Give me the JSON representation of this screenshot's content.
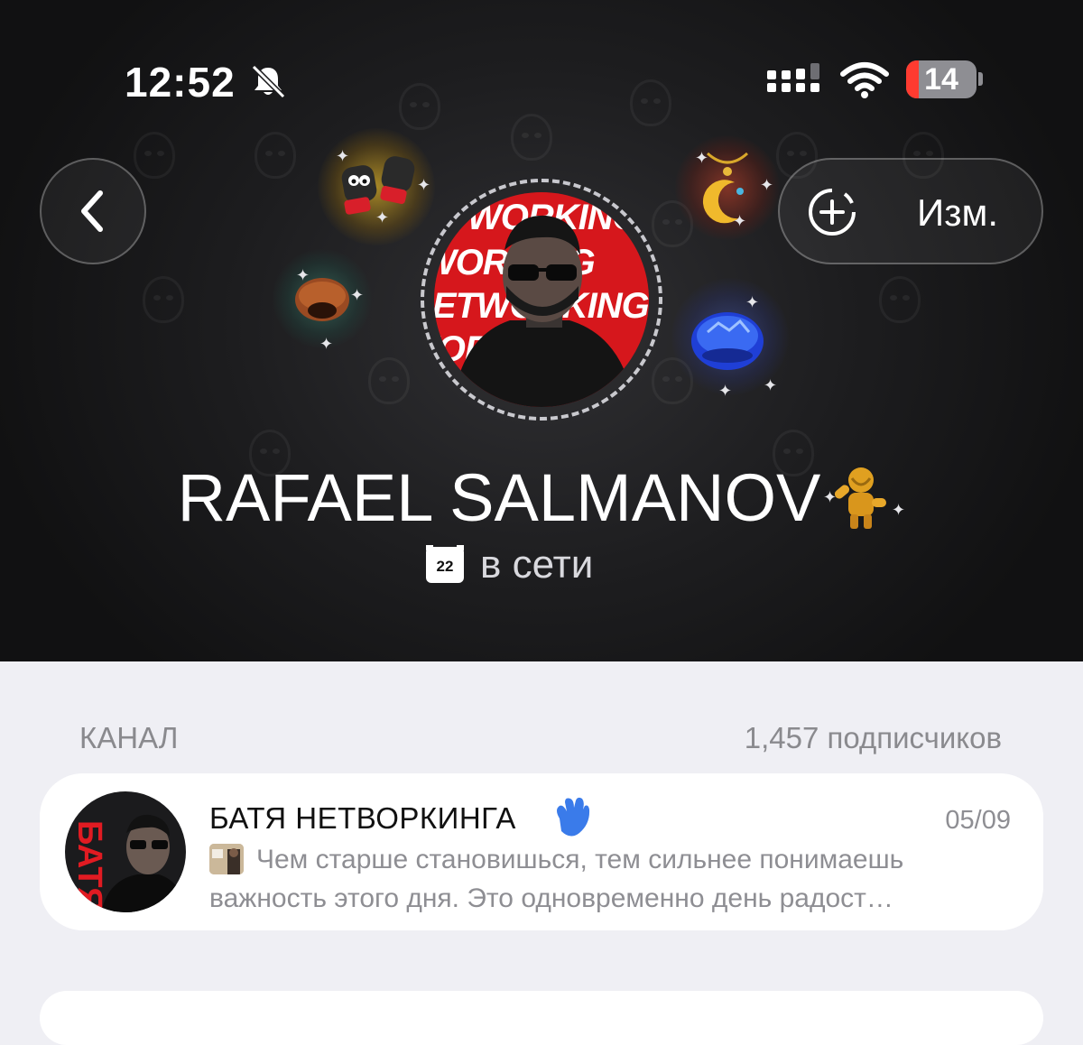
{
  "status_bar": {
    "time": "12:52",
    "battery_level": "14",
    "icons": [
      "bell-slash-icon",
      "cellular-signal-icon",
      "wifi-icon",
      "battery-icon"
    ]
  },
  "header": {
    "back_icon": "chevron-left-icon",
    "edit_label": "Изм.",
    "edit_icon": "add-circle-dashed-icon"
  },
  "profile": {
    "name": "RAFAEL SALMANOV",
    "status": "в сети",
    "date_badge": "22",
    "avatar_text": [
      "NETWORKING",
      "NETWORKING",
      "NETWORKING",
      "NETWORKING"
    ],
    "gifts": [
      "boxing-gloves-gift-icon",
      "crescent-pendant-gift-icon",
      "hair-bun-gift-icon",
      "blue-gem-gift-icon"
    ],
    "emoji_status": "golden-figure-icon"
  },
  "channel_section": {
    "label": "КАНАЛ",
    "subscribers": "1,457 подписчиков",
    "channel": {
      "title": "БАТЯ НЕТВОРКИНГА",
      "title_emoji": "waving-hand-icon",
      "date": "05/09",
      "preview": "Чем старше становишься, тем сильнее понимаешь важность этого дня. Это одновременно день радост…",
      "avatar_text": "БАТЯ"
    }
  },
  "colors": {
    "header_bg": "#1d1d1f",
    "page_bg": "#efeff4",
    "battery_low": "#ff3b30",
    "avatar_red": "#d6171c",
    "secondary_text": "#8e8e93"
  }
}
